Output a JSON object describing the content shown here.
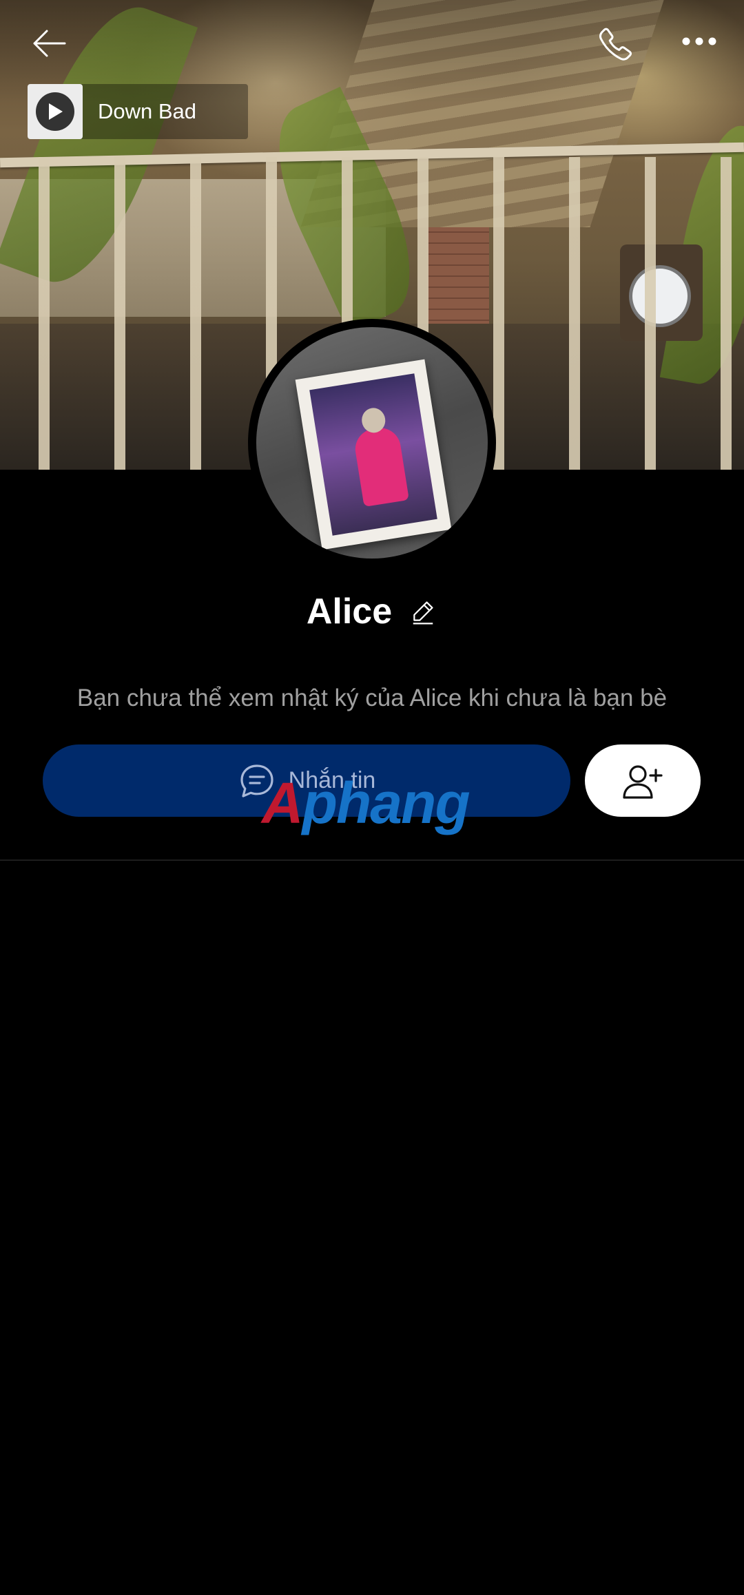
{
  "header": {
    "back_icon": "arrow-left-icon",
    "call_icon": "phone-icon",
    "more_icon": "more-horizontal-icon"
  },
  "music": {
    "title": "Down Bad",
    "icon": "play-icon"
  },
  "profile": {
    "name": "Alice",
    "edit_icon": "pencil-icon",
    "notice": "Bạn chưa thể xem nhật ký của Alice khi chưa là bạn bè"
  },
  "actions": {
    "message_label": "Nhắn tin",
    "message_icon": "chat-bubble-icon",
    "add_friend_icon": "add-user-icon"
  },
  "watermark": {
    "first": "A",
    "rest": "phang"
  },
  "colors": {
    "background": "#000000",
    "message_button": "#002a6b",
    "add_button": "#ffffff",
    "notice_text": "#a0a0a0"
  }
}
